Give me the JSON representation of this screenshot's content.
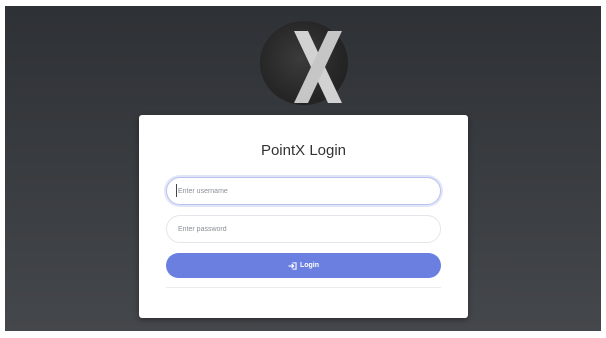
{
  "logo": {
    "letter": "X"
  },
  "login": {
    "title": "PointX Login",
    "username_placeholder": "Enter username",
    "username_value": "",
    "password_placeholder": "Enter password",
    "password_value": "",
    "button_label": "Login",
    "button_icon": "sign-in-icon"
  },
  "colors": {
    "background": "#34373b",
    "card": "#ffffff",
    "accent": "#6a7fe0",
    "logo_letter": "#cfcfcf"
  }
}
